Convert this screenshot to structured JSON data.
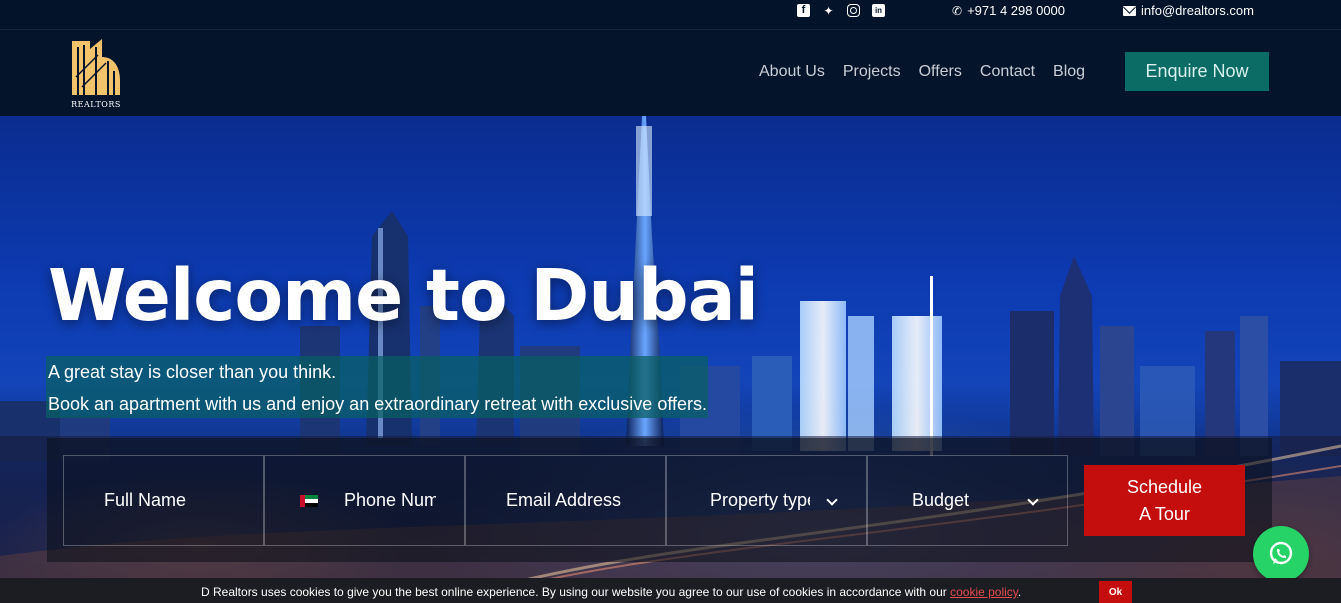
{
  "topbar": {
    "social": [
      "facebook-icon",
      "twitter-icon",
      "instagram-icon",
      "linkedin-icon"
    ],
    "phone": "+971 4 298 0000",
    "email": "info@drealtors.com"
  },
  "brand": {
    "logo_text": "REALTORS",
    "logo_color": "#f3c36b"
  },
  "nav": {
    "links": [
      "About Us",
      "Projects",
      "Offers",
      "Contact",
      "Blog"
    ],
    "enquire_label": "Enquire Now"
  },
  "hero": {
    "title": "Welcome to Dubai",
    "tagline_1": "A great stay is closer than you think.",
    "tagline_2": "Book an apartment with us and enjoy an extraordinary retreat with exclusive offers."
  },
  "form": {
    "full_name": "Full Name",
    "phone": "Phone Number",
    "email": "Email Address",
    "property_type": "Property type",
    "budget": "Budget",
    "schedule_line1": "Schedule",
    "schedule_line2": "A Tour",
    "flag_colors": [
      "#c8102e",
      "#00843d",
      "#ffffff",
      "#000000"
    ]
  },
  "cookie": {
    "text": "D Realtors uses cookies to give you the best online experience. By using our website you agree to our use of cookies in accordance with our ",
    "link": "cookie policy",
    "suffix": ".",
    "ok_label": "Ok"
  },
  "colors": {
    "nav_bg": "#04142b",
    "accent_teal": "#0b6b65",
    "accent_red": "#c40d0d",
    "whatsapp_green": "#25d366"
  }
}
